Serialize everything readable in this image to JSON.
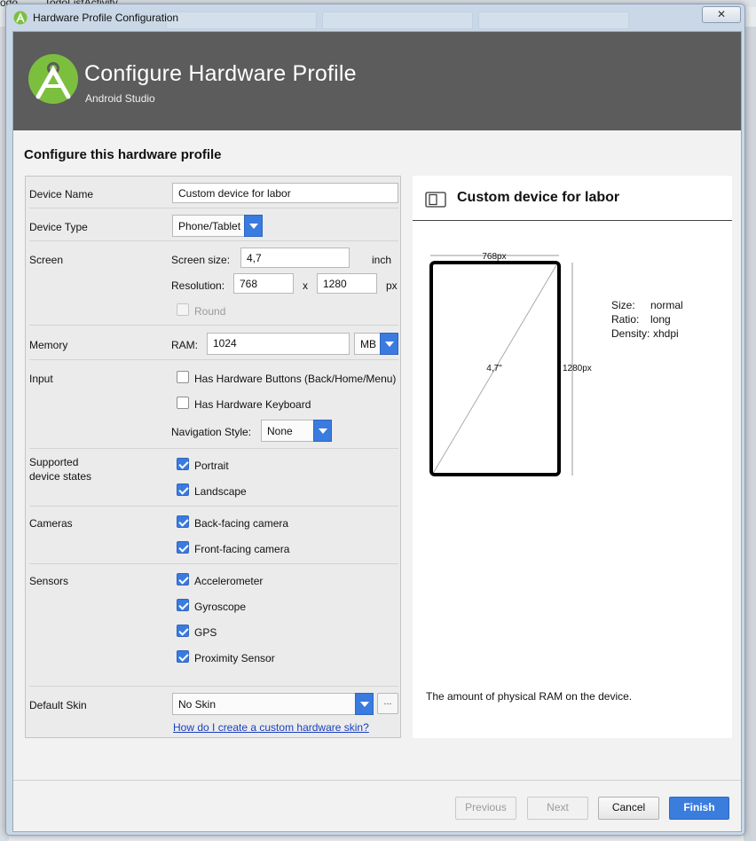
{
  "background": {
    "tab_text": "TodoListActivity",
    "left_text": "odo"
  },
  "window": {
    "title": "Hardware Profile Configuration",
    "close_label": "✕"
  },
  "header": {
    "title": "Configure Hardware Profile",
    "subtitle": "Android Studio"
  },
  "section_title": "Configure this hardware profile",
  "form": {
    "device_name": {
      "label": "Device Name",
      "value": "Custom device for labor"
    },
    "device_type": {
      "label": "Device Type",
      "value": "Phone/Tablet"
    },
    "screen": {
      "label": "Screen",
      "size_label": "Screen size:",
      "size_value": "4,7",
      "size_unit": "inch",
      "resolution_label": "Resolution:",
      "res_width": "768",
      "res_x": "x",
      "res_height": "1280",
      "res_unit": "px",
      "round_label": "Round",
      "round_checked": false
    },
    "memory": {
      "label": "Memory",
      "ram_label": "RAM:",
      "ram_value": "1024",
      "unit": "MB"
    },
    "input": {
      "label": "Input",
      "hw_buttons_label": "Has Hardware Buttons (Back/Home/Menu)",
      "hw_buttons_checked": false,
      "hw_keyboard_label": "Has Hardware Keyboard",
      "hw_keyboard_checked": false,
      "nav_style_label": "Navigation Style:",
      "nav_style_value": "None"
    },
    "device_states": {
      "label_line1": "Supported",
      "label_line2": "device states",
      "portrait_label": "Portrait",
      "landscape_label": "Landscape"
    },
    "cameras": {
      "label": "Cameras",
      "back_label": "Back-facing camera",
      "front_label": "Front-facing camera"
    },
    "sensors": {
      "label": "Sensors",
      "accelerometer": "Accelerometer",
      "gyroscope": "Gyroscope",
      "gps": "GPS",
      "proximity": "Proximity Sensor"
    },
    "skin": {
      "label": "Default Skin",
      "value": "No Skin",
      "more_label": "...",
      "help_link": "How do I create a custom hardware skin?"
    }
  },
  "preview": {
    "title": "Custom device for labor",
    "width_label": "768px",
    "height_label": "1280px",
    "diagonal_label": "4,7\"",
    "size_key": "Size:",
    "size_val": "normal",
    "ratio_key": "Ratio:",
    "ratio_val": "long",
    "density_key": "Density:",
    "density_val": "xhdpi",
    "help_text": "The amount of physical RAM on the device."
  },
  "buttons": {
    "previous": "Previous",
    "next": "Next",
    "cancel": "Cancel",
    "finish": "Finish"
  },
  "colors": {
    "accent": "#3a7be0",
    "header_bg": "#5c5c5c",
    "logo_green": "#7cbf3f"
  }
}
